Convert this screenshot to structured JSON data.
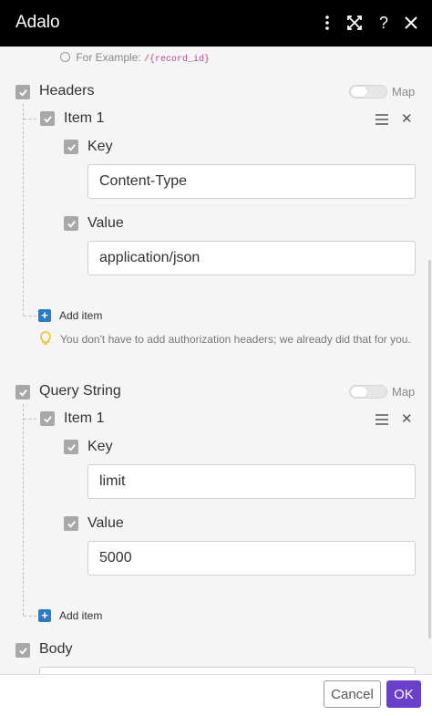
{
  "app": {
    "title": "Adalo"
  },
  "header_icons": [
    "more-vertical-icon",
    "maximize-icon",
    "help-icon",
    "close-icon"
  ],
  "example": {
    "prefix": "For Example:",
    "code": "/{record_id}"
  },
  "headers": {
    "label": "Headers",
    "map_label": "Map",
    "item_label": "Item 1",
    "key_label": "Key",
    "key_value": "Content-Type",
    "value_label": "Value",
    "value_value": "application/json",
    "add_item": "Add item",
    "hint": "You don't have to add authorization headers; we already did that for you."
  },
  "query_string": {
    "label": "Query String",
    "map_label": "Map",
    "item_label": "Item 1",
    "key_label": "Key",
    "key_value": "limit",
    "value_label": "Value",
    "value_value": "5000",
    "add_item": "Add item"
  },
  "body": {
    "label": "Body"
  },
  "footer": {
    "cancel": "Cancel",
    "ok": "OK"
  },
  "colors": {
    "accent": "#6a3fc9",
    "header_bg": "#000000",
    "add_blue": "#2e7bc4"
  }
}
